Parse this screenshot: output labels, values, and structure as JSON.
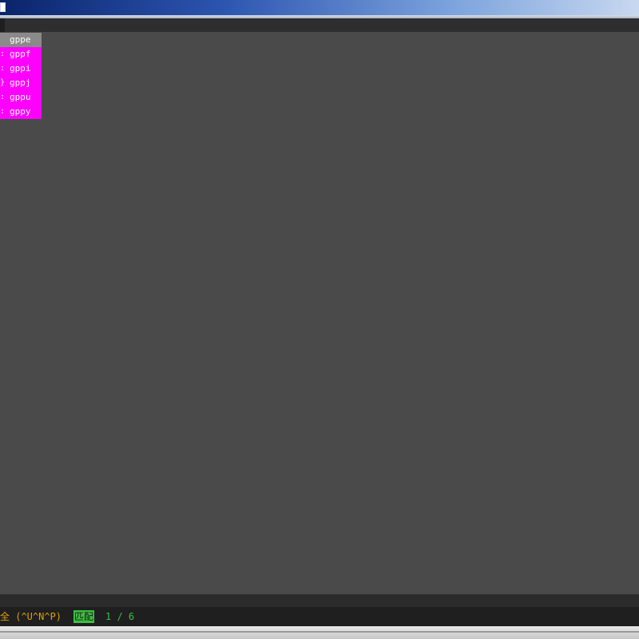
{
  "window": {
    "title_icon": "application-icon"
  },
  "completion_menu": {
    "items": [
      {
        "lead": "",
        "word": "gppe",
        "selected": true
      },
      {
        "lead": ":",
        "word": "gppf",
        "selected": false
      },
      {
        "lead": ":",
        "word": "gppi",
        "selected": false
      },
      {
        "lead": "}",
        "word": "gppj",
        "selected": false
      },
      {
        "lead": ":",
        "word": "gppu",
        "selected": false
      },
      {
        "lead": ":",
        "word": "gppy",
        "selected": false
      }
    ],
    "colors": {
      "item_bg": "#ff00ff",
      "selected_bg": "#8a8a8a",
      "text": "#ffffff"
    }
  },
  "command_line": {
    "text": "全 (^U^N^P)",
    "match_label": "匹配",
    "count": "1 / 6",
    "colors": {
      "text": "#e0a000",
      "match_bg": "#3cc040"
    }
  }
}
